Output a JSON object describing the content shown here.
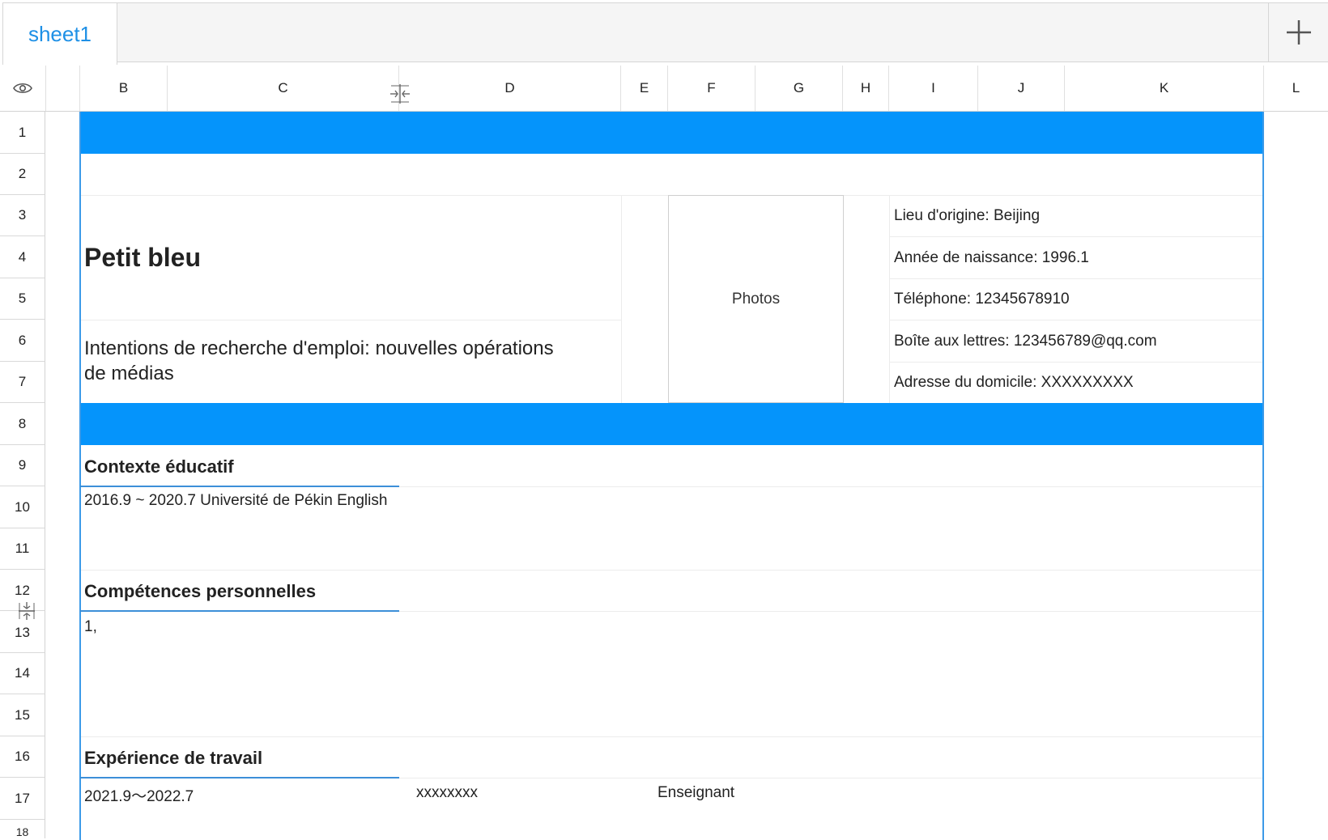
{
  "tabs": {
    "items": [
      {
        "label": "sheet1"
      }
    ],
    "add_label": "+"
  },
  "columns": [
    "B",
    "C",
    "D",
    "E",
    "F",
    "G",
    "H",
    "I",
    "J",
    "K",
    "L"
  ],
  "rows": [
    "1",
    "2",
    "3",
    "4",
    "5",
    "6",
    "7",
    "8",
    "9",
    "10",
    "11",
    "12",
    "13",
    "14",
    "15",
    "16",
    "17",
    "18"
  ],
  "colors": {
    "accent_band": "#0594fb",
    "tab_text": "#1e90e6",
    "section_underline": "#3c8fd8"
  },
  "resume": {
    "name": "Petit bleu",
    "intention_line1": "Intentions de recherche d'emploi: nouvelles opérations",
    "intention_line2": "de médias",
    "photo_label": "Photos",
    "info": [
      "Lieu d'origine: Beijing",
      "Année de naissance: 1996.1",
      "Téléphone: 12345678910",
      "Boîte aux lettres: 123456789@qq.com",
      "Adresse du domicile: XXXXXXXXX"
    ],
    "education_title": "Contexte éducatif",
    "education_item": "2016.9 ~ 2020.7 Université de Pékin English",
    "skills_title": "Compétences personnelles",
    "skills_item": "1,",
    "work_title": "Expérience de travail",
    "work_period": "2021.9～2022.7",
    "work_company": "xxxxxxxx",
    "work_role": "Enseignant"
  }
}
